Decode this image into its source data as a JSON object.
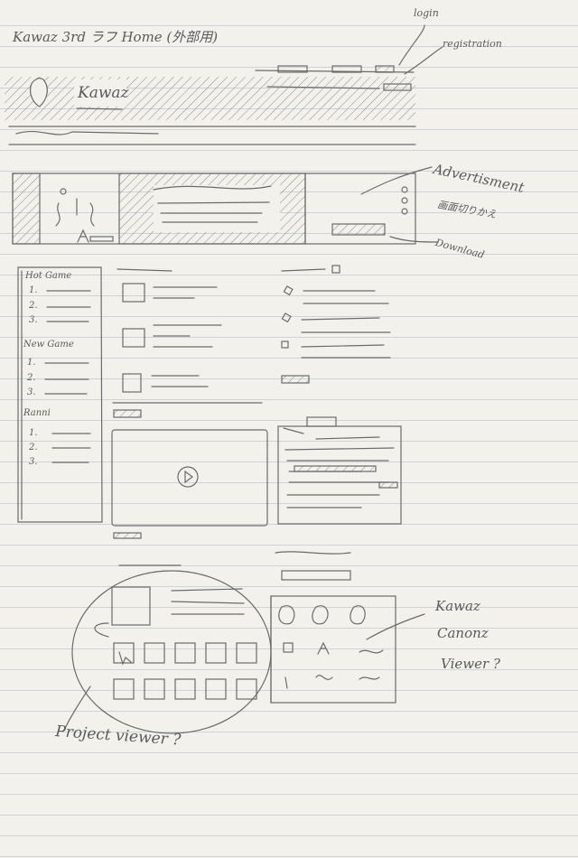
{
  "title": "Kawaz 3rd ラフ Home (外部用)",
  "logo_text": "Kawaz",
  "annotations": {
    "login": "login",
    "registration": "registration",
    "advertisement": "Advertisment",
    "advertisement_note": "画面切りかえ",
    "download": "Download",
    "canvas_viewer_line1": "Kawaz",
    "canvas_viewer_line2": "Canonz",
    "canvas_viewer_line3": "Viewer ?",
    "project_viewer": "Project viewer ?"
  },
  "sidebar": {
    "sections": [
      {
        "heading": "Hot Game",
        "items": [
          "1.",
          "2.",
          "3."
        ]
      },
      {
        "heading": "New Game",
        "items": [
          "1.",
          "2.",
          "3."
        ]
      },
      {
        "heading": "Ranni",
        "items": [
          "1.",
          "2.",
          "3."
        ]
      }
    ]
  },
  "colors": {
    "pencil": "#6b6b6b",
    "paper": "#f2f1ec",
    "rule": "#cfd3d8"
  }
}
